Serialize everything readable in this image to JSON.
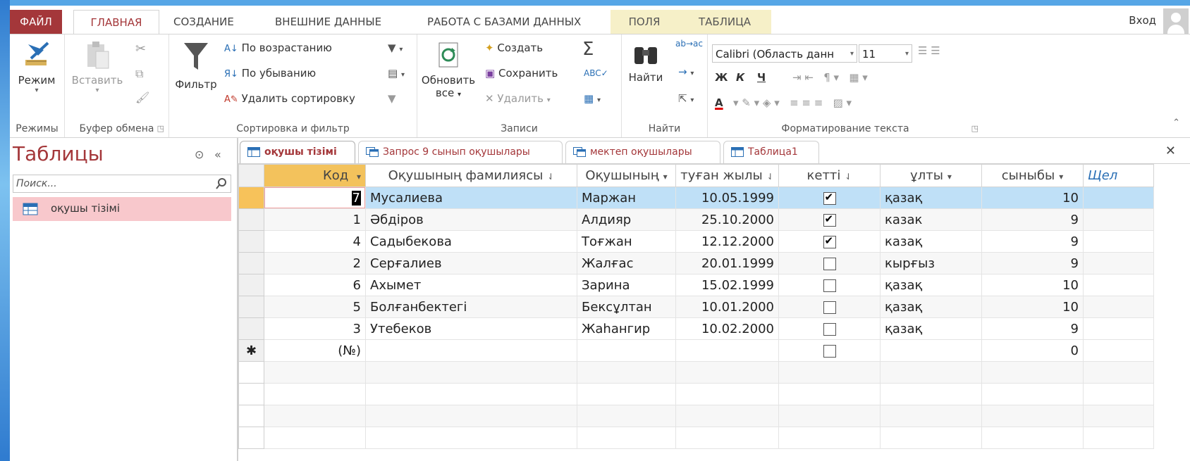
{
  "tabs": {
    "file": "ФАЙЛ",
    "home": "ГЛАВНАЯ",
    "create": "СОЗДАНИЕ",
    "external": "ВНЕШНИЕ ДАННЫЕ",
    "dbtools": "РАБОТА С БАЗАМИ ДАННЫХ",
    "fields": "ПОЛЯ",
    "table": "ТАБЛИЦА"
  },
  "account": {
    "login": "Вход"
  },
  "ribbon": {
    "views": {
      "mode": "Режим",
      "group": "Режимы"
    },
    "clipboard": {
      "paste": "Вставить",
      "group": "Буфер обмена"
    },
    "sortfilter": {
      "filter": "Фильтр",
      "asc": "По возрастанию",
      "desc": "По убыванию",
      "remove_sort": "Удалить сортировку",
      "group": "Сортировка и фильтр"
    },
    "records": {
      "refresh_line1": "Обновить",
      "refresh_line2": "все",
      "new": "Создать",
      "save": "Сохранить",
      "delete": "Удалить",
      "group": "Записи"
    },
    "find": {
      "find": "Найти",
      "group": "Найти"
    },
    "text": {
      "font": "Calibri (Область данн",
      "size": "11",
      "bold": "Ж",
      "italic": "К",
      "underline": "Ч",
      "font_color": "A",
      "group": "Форматирование текста"
    }
  },
  "nav": {
    "title": "Таблицы",
    "search_placeholder": "Поиск...",
    "items": [
      {
        "label": "оқушы тізімі"
      }
    ]
  },
  "doc_tabs": [
    {
      "label": "оқушы тізімі"
    },
    {
      "label": "Запрос 9 сынып оқушылары"
    },
    {
      "label": "мектеп оқушылары"
    },
    {
      "label": "Таблица1"
    }
  ],
  "table": {
    "columns": [
      "Код",
      "Оқушының фамилиясы",
      "Оқушының",
      "туған жылы",
      "кетті",
      "ұлты",
      "сыныбы",
      "Щел"
    ],
    "rows": [
      {
        "id": "7",
        "surname": "Мусалиева",
        "name": "Маржан",
        "born": "10.05.1999",
        "left": true,
        "nation": "қазақ",
        "grade": "10"
      },
      {
        "id": "1",
        "surname": "Әбдіров",
        "name": "Алдияр",
        "born": "25.10.2000",
        "left": true,
        "nation": "казак",
        "grade": "9"
      },
      {
        "id": "4",
        "surname": "Садыбекова",
        "name": "Тоғжан",
        "born": "12.12.2000",
        "left": true,
        "nation": "казақ",
        "grade": "9"
      },
      {
        "id": "2",
        "surname": "Серғалиев",
        "name": "Жалғас",
        "born": "20.01.1999",
        "left": false,
        "nation": "кырғыз",
        "grade": "9"
      },
      {
        "id": "6",
        "surname": "Ахымет",
        "name": "Зарина",
        "born": "15.02.1999",
        "left": false,
        "nation": "қазақ",
        "grade": "10"
      },
      {
        "id": "5",
        "surname": "Болғанбектегі",
        "name": "Бексұлтан",
        "born": "10.01.2000",
        "left": false,
        "nation": "қазақ",
        "grade": "10"
      },
      {
        "id": "3",
        "surname": "Утебеков",
        "name": "Жаһангир",
        "born": "10.02.2000",
        "left": false,
        "nation": "қазақ",
        "grade": "9"
      }
    ],
    "new_row": {
      "marker": "✱",
      "id": "(№)",
      "grade": "0"
    }
  },
  "colors": {
    "accent": "#a4373a",
    "selected_row": "#bfe0f7",
    "header_key": "#f3c25c"
  }
}
